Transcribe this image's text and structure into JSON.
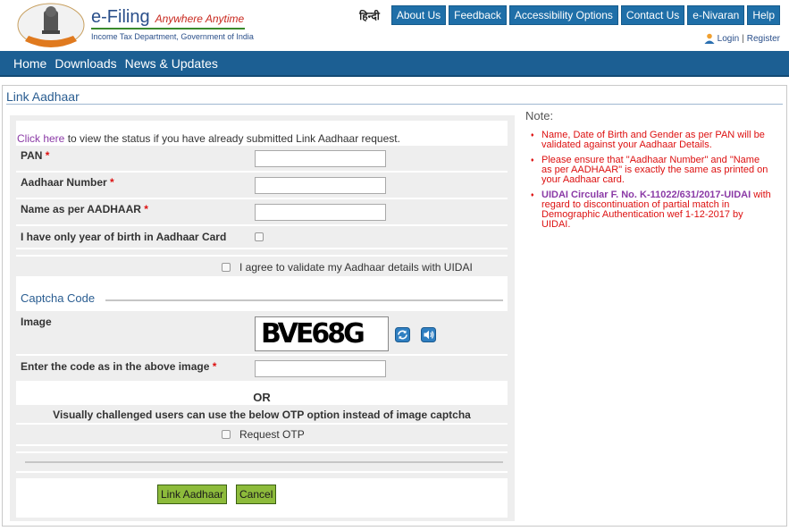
{
  "header": {
    "brand_title": "e-Filing",
    "brand_tagline": "Anywhere Anytime",
    "brand_subtitle": "Income Tax Department, Government of India",
    "hindi_label": "हिन्दी",
    "top_links": [
      "About Us",
      "Feedback",
      "Accessibility Options",
      "Contact Us",
      "e-Nivaran",
      "Help"
    ],
    "login_label": "Login",
    "login_separator": "|",
    "register_label": "Register"
  },
  "mainnav": {
    "items": [
      "Home",
      "Downloads",
      "News & Updates"
    ]
  },
  "page": {
    "title": "Link Aadhaar"
  },
  "form": {
    "status_link": "Click here",
    "status_text": " to view the status if you have already submitted Link Aadhaar request.",
    "pan_label": "PAN",
    "aadhaar_label": "Aadhaar Number",
    "name_label": "Name as per AADHAAR",
    "required_marker": "*",
    "yob_label": "I have only year of birth in Aadhaar Card",
    "agree_label": "I agree to validate my Aadhaar details with UIDAI",
    "captcha_heading": "Captcha Code",
    "image_label": "Image",
    "captcha_text": "BVE68G",
    "code_label": "Enter the code as in the above image",
    "or_label": "OR",
    "otp_info": "Visually challenged users can use the below OTP option instead of image captcha",
    "otp_label": "Request OTP",
    "link_button": "Link Aadhaar",
    "cancel_button": "Cancel"
  },
  "notes": {
    "heading": "Note:",
    "items": [
      "Name, Date of Birth and Gender as per PAN will be validated against your Aadhaar Details.",
      "Please ensure that \"Aadhaar Number\" and \"Name as per AADHAAR\" is exactly the same as printed on your Aadhaar card."
    ],
    "circular_link": "UIDAI Circular F. No. K-11022/631/2017-UIDAI",
    "circular_text": " with regard to discontinuation of partial match in Demographic Authentication wef 1-12-2017 by UIDAI."
  },
  "icons": {
    "emblem": "national-emblem-icon",
    "user": "user-icon",
    "refresh": "refresh-icon",
    "audio": "speaker-icon"
  },
  "colors": {
    "nav_blue": "#1c5f93",
    "button_green": "#8dbb3b",
    "note_red": "#dd1111",
    "link_purple": "#8b3aa6"
  }
}
